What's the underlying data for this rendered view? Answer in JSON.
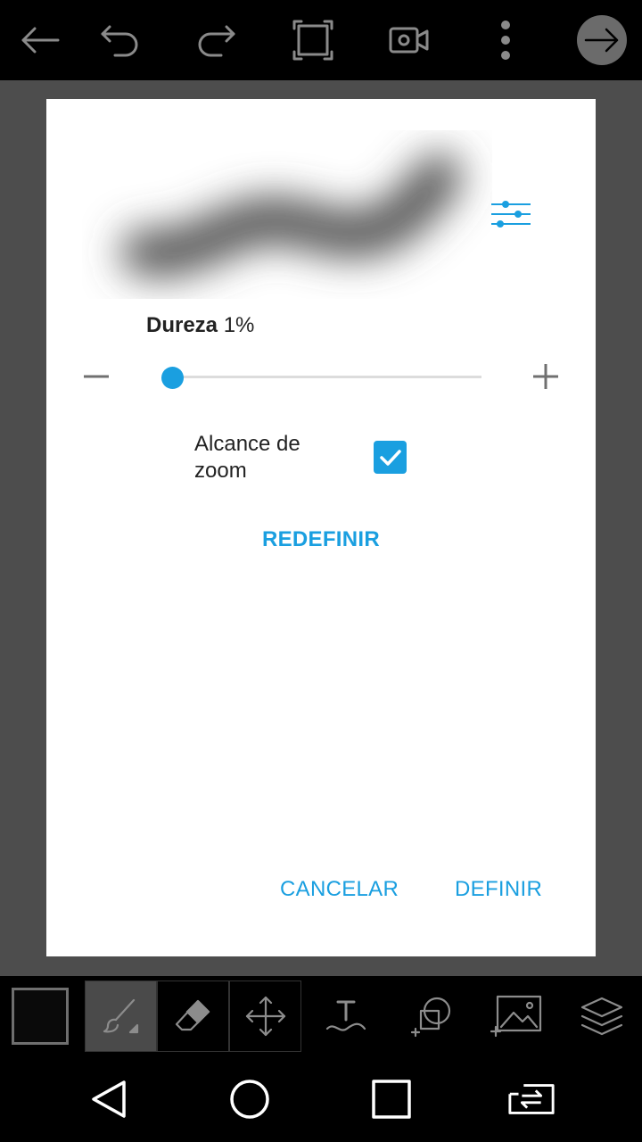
{
  "brush_settings": {
    "hardness_label": "Dureza",
    "hardness_value": "1%",
    "hardness_percent": 1,
    "zoom_range_label": "Alcance de zoom",
    "zoom_range_checked": true,
    "reset_label": "REDEFINIR",
    "cancel_label": "CANCELAR",
    "ok_label": "DEFINIR"
  },
  "colors": {
    "accent": "#1a9fe0",
    "current_color": "#0a0a0a"
  },
  "top_toolbar": {
    "icons": [
      "back-icon",
      "undo-icon",
      "redo-icon",
      "fullscreen-icon",
      "video-icon",
      "more-icon",
      "next-icon"
    ]
  },
  "bottom_toolbar": {
    "tools": [
      "brush-icon",
      "eraser-icon",
      "move-icon",
      "text-icon",
      "shape-icon",
      "add-image-icon",
      "layers-icon"
    ]
  },
  "nav": {
    "icons": [
      "nav-back-icon",
      "nav-home-icon",
      "nav-recents-icon",
      "nav-switch-icon"
    ]
  }
}
